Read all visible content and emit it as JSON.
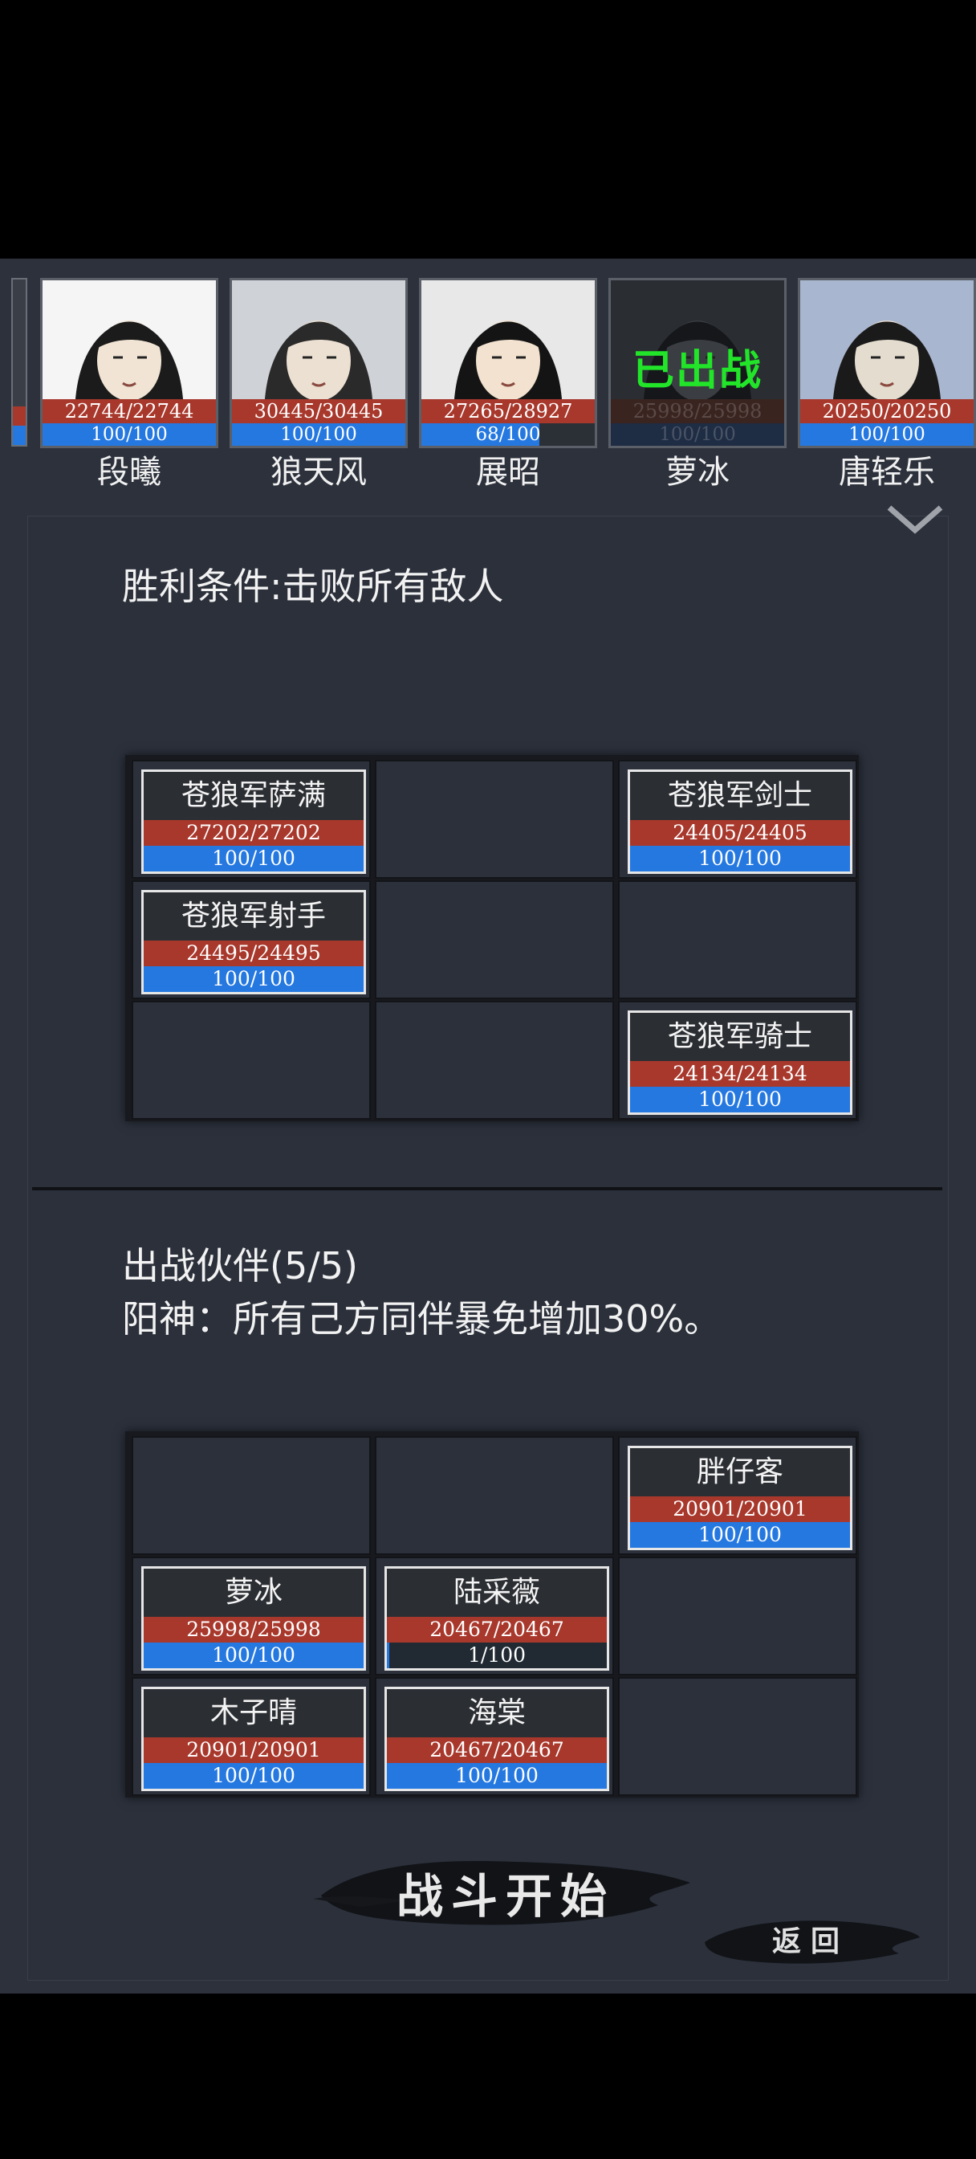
{
  "roster": [
    {
      "name": "段曦",
      "hp": "22744/22744",
      "mp": "100/100",
      "mp_fraction": 1.0,
      "deployed": false
    },
    {
      "name": "狼天风",
      "hp": "30445/30445",
      "mp": "100/100",
      "mp_fraction": 1.0,
      "deployed": false
    },
    {
      "name": "展昭",
      "hp": "27265/28927",
      "mp": "68/100",
      "mp_fraction": 0.68,
      "deployed": false
    },
    {
      "name": "萝冰",
      "hp": "25998/25998",
      "mp": "100/100",
      "mp_fraction": 1.0,
      "deployed": true,
      "deployed_label": "已出战"
    },
    {
      "name": "唐轻乐",
      "hp": "20250/20250",
      "mp": "100/100",
      "mp_fraction": 1.0,
      "deployed": false
    }
  ],
  "victory_condition": "胜利条件:击败所有敌人",
  "enemy_grid": [
    {
      "row": 0,
      "col": 0,
      "name": "苍狼军萨满",
      "hp": "27202/27202",
      "mp": "100/100",
      "mp_fraction": 1.0
    },
    {
      "row": 0,
      "col": 2,
      "name": "苍狼军剑士",
      "hp": "24405/24405",
      "mp": "100/100",
      "mp_fraction": 1.0
    },
    {
      "row": 1,
      "col": 0,
      "name": "苍狼军射手",
      "hp": "24495/24495",
      "mp": "100/100",
      "mp_fraction": 1.0
    },
    {
      "row": 2,
      "col": 2,
      "name": "苍狼军骑士",
      "hp": "24134/24134",
      "mp": "100/100",
      "mp_fraction": 1.0
    }
  ],
  "party_title": "出战伙伴(5/5)",
  "party_bonus": "阳神：所有己方同伴暴免增加30%。",
  "party_grid": [
    {
      "row": 0,
      "col": 2,
      "name": "胖仔客",
      "hp": "20901/20901",
      "mp": "100/100",
      "mp_fraction": 1.0
    },
    {
      "row": 1,
      "col": 0,
      "name": "萝冰",
      "hp": "25998/25998",
      "mp": "100/100",
      "mp_fraction": 1.0
    },
    {
      "row": 1,
      "col": 1,
      "name": "陆采薇",
      "hp": "20467/20467",
      "mp": "1/100",
      "mp_fraction": 0.01
    },
    {
      "row": 2,
      "col": 0,
      "name": "木子晴",
      "hp": "20901/20901",
      "mp": "100/100",
      "mp_fraction": 1.0
    },
    {
      "row": 2,
      "col": 1,
      "name": "海棠",
      "hp": "20467/20467",
      "mp": "100/100",
      "mp_fraction": 1.0
    }
  ],
  "buttons": {
    "start": "战斗开始",
    "back": "返回"
  },
  "icons": {
    "collapse": "chevron-down-icon"
  },
  "colors": {
    "hp": "#a8382c",
    "mp": "#2478e0",
    "deployed_text": "#22e52a",
    "panel": "#2b303b"
  }
}
